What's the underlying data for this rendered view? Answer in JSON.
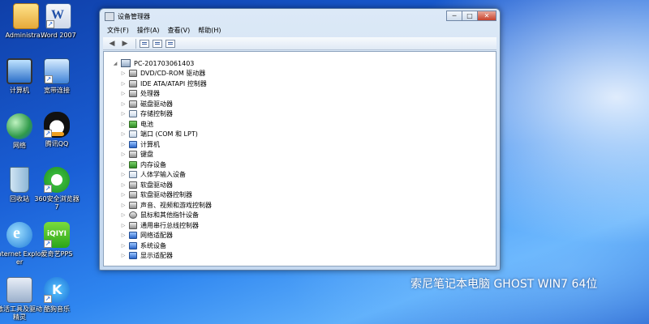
{
  "desktop": {
    "icons": [
      {
        "label": "Administra...",
        "icon": "user-folder-icon"
      },
      {
        "label": "Word 2007",
        "icon": "word-icon"
      },
      {
        "label": "计算机",
        "icon": "computer-icon"
      },
      {
        "label": "宽带连接",
        "icon": "broadband-icon"
      },
      {
        "label": "网络",
        "icon": "network-icon"
      },
      {
        "label": "腾讯QQ",
        "icon": "qq-icon"
      },
      {
        "label": "回收站",
        "icon": "recycle-bin-icon"
      },
      {
        "label": "360安全浏览器7",
        "icon": "360-browser-icon"
      },
      {
        "label": "Internet Explorer",
        "icon": "ie-icon"
      },
      {
        "label": "爱奇艺PPS",
        "icon": "iqiyi-icon"
      },
      {
        "label": "激活工具及驱动精灵",
        "icon": "tools-icon"
      },
      {
        "label": "酷狗音乐",
        "icon": "kugou-icon"
      }
    ],
    "brand_text": "索尼笔记本电脑 GHOST WIN7 64位"
  },
  "window": {
    "title": "设备管理器",
    "controls": {
      "minimize": "─",
      "maximize": "□",
      "close": "✕"
    },
    "menu": [
      "文件(F)",
      "操作(A)",
      "查看(V)",
      "帮助(H)"
    ],
    "tree": {
      "root": "PC-201703061403",
      "nodes": [
        {
          "label": "DVD/CD-ROM 驱动器",
          "icon": "dvd-icon"
        },
        {
          "label": "IDE ATA/ATAPI 控制器",
          "icon": "ide-icon"
        },
        {
          "label": "处理器",
          "icon": "processor-icon"
        },
        {
          "label": "磁盘驱动器",
          "icon": "disk-icon"
        },
        {
          "label": "存储控制器",
          "icon": "storage-icon"
        },
        {
          "label": "电池",
          "icon": "battery-icon"
        },
        {
          "label": "端口 (COM 和 LPT)",
          "icon": "port-icon"
        },
        {
          "label": "计算机",
          "icon": "computer-icon"
        },
        {
          "label": "键盘",
          "icon": "keyboard-icon"
        },
        {
          "label": "内存设备",
          "icon": "memory-icon"
        },
        {
          "label": "人体学输入设备",
          "icon": "hid-icon"
        },
        {
          "label": "软盘驱动器",
          "icon": "floppy-icon"
        },
        {
          "label": "软盘驱动器控制器",
          "icon": "floppy-controller-icon"
        },
        {
          "label": "声音、视频和游戏控制器",
          "icon": "sound-icon"
        },
        {
          "label": "鼠标和其他指针设备",
          "icon": "mouse-icon"
        },
        {
          "label": "通用串行总线控制器",
          "icon": "usb-icon"
        },
        {
          "label": "网络适配器",
          "icon": "network-adapter-icon"
        },
        {
          "label": "系统设备",
          "icon": "system-icon"
        },
        {
          "label": "显示适配器",
          "icon": "display-icon"
        }
      ]
    }
  }
}
